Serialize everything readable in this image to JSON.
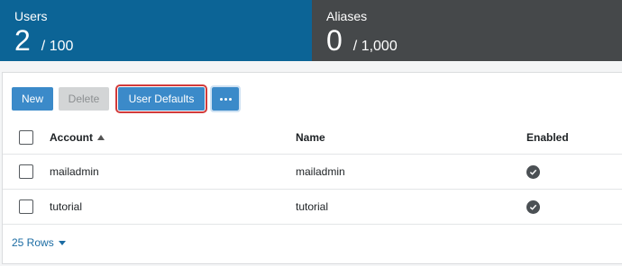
{
  "stats": {
    "users": {
      "label": "Users",
      "count": "2",
      "limit": "/ 100"
    },
    "aliases": {
      "label": "Aliases",
      "count": "0",
      "limit": "/ 1,000"
    }
  },
  "toolbar": {
    "new_label": "New",
    "delete_label": "Delete",
    "user_defaults_label": "User Defaults",
    "more_icon": "more-horizontal-icon"
  },
  "table": {
    "columns": [
      "Account",
      "Name",
      "Enabled"
    ],
    "sort": {
      "column": "Account",
      "direction": "ascending"
    },
    "rows": [
      {
        "account": "mailadmin",
        "name": "mailadmin",
        "enabled": true
      },
      {
        "account": "tutorial",
        "name": "tutorial",
        "enabled": true
      }
    ]
  },
  "footer": {
    "rows_label": "25 Rows"
  },
  "colors": {
    "users_bg": "#0c6496",
    "aliases_bg": "#45484a",
    "primary_button": "#3b8ac9",
    "highlight_outline": "#d23a3a"
  }
}
